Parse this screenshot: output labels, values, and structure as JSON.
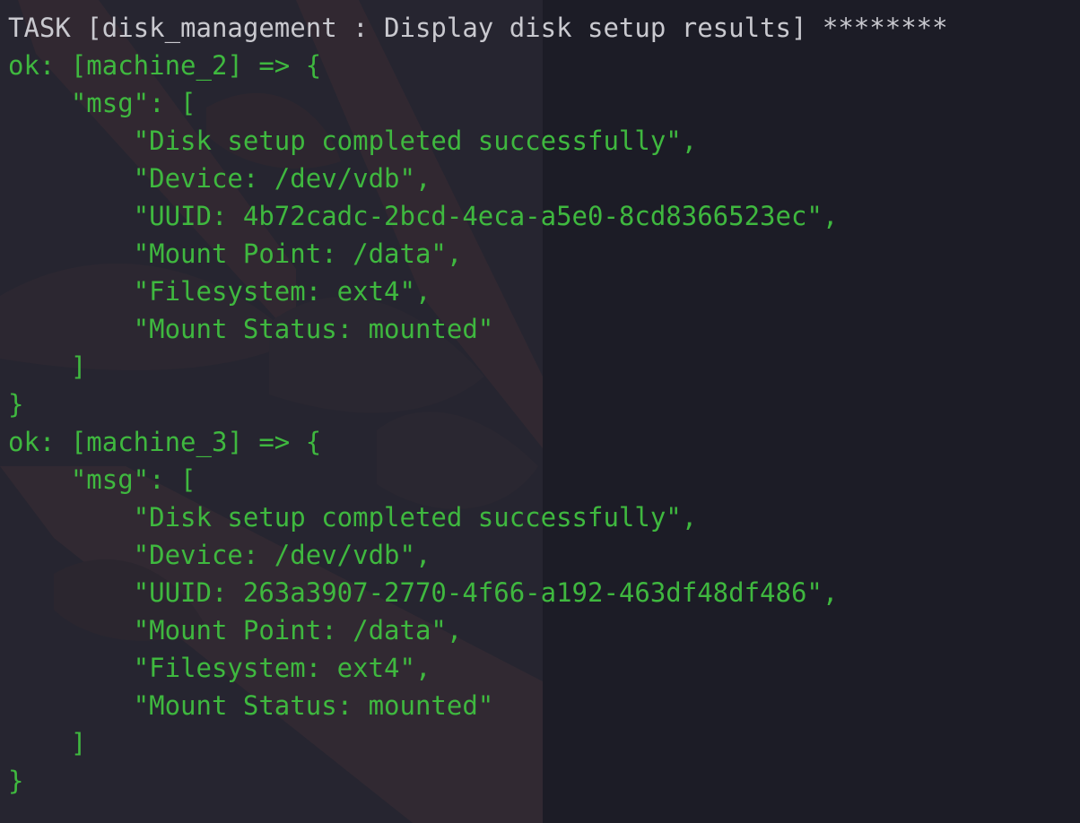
{
  "theme": {
    "background": "#1c1c26",
    "task_text_color": "#c9c9cf",
    "ok_text_color": "#3fb83f"
  },
  "terminal": {
    "lines": [
      {
        "text": "TASK [disk_management : Display disk setup results] ********",
        "style": "white"
      },
      {
        "text": "ok: [machine_2] => {",
        "style": "green"
      },
      {
        "text": "    \"msg\": [",
        "style": "green"
      },
      {
        "text": "        \"Disk setup completed successfully\",",
        "style": "green"
      },
      {
        "text": "        \"Device: /dev/vdb\",",
        "style": "green"
      },
      {
        "text": "        \"UUID: 4b72cadc-2bcd-4eca-a5e0-8cd8366523ec\",",
        "style": "green"
      },
      {
        "text": "        \"Mount Point: /data\",",
        "style": "green"
      },
      {
        "text": "        \"Filesystem: ext4\",",
        "style": "green"
      },
      {
        "text": "        \"Mount Status: mounted\"",
        "style": "green"
      },
      {
        "text": "    ]",
        "style": "green"
      },
      {
        "text": "}",
        "style": "green"
      },
      {
        "text": "ok: [machine_3] => {",
        "style": "green"
      },
      {
        "text": "    \"msg\": [",
        "style": "green"
      },
      {
        "text": "        \"Disk setup completed successfully\",",
        "style": "green"
      },
      {
        "text": "        \"Device: /dev/vdb\",",
        "style": "green"
      },
      {
        "text": "        \"UUID: 263a3907-2770-4f66-a192-463df48df486\",",
        "style": "green"
      },
      {
        "text": "        \"Mount Point: /data\",",
        "style": "green"
      },
      {
        "text": "        \"Filesystem: ext4\",",
        "style": "green"
      },
      {
        "text": "        \"Mount Status: mounted\"",
        "style": "green"
      },
      {
        "text": "    ]",
        "style": "green"
      },
      {
        "text": "}",
        "style": "green"
      }
    ]
  }
}
